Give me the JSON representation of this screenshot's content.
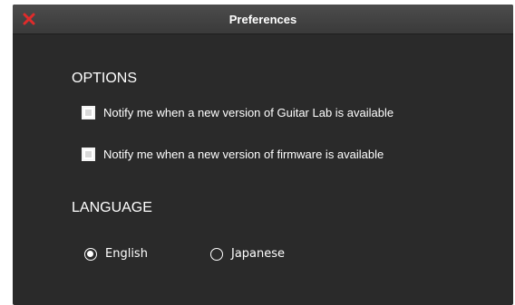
{
  "window": {
    "title": "Preferences"
  },
  "colors": {
    "background": "#2a2a2a",
    "titlebar": "#434343",
    "close_icon": "#e02b2b",
    "text": "#ffffff"
  },
  "options": {
    "heading": "OPTIONS",
    "items": [
      {
        "label": "Notify me when a new version of Guitar Lab is available",
        "checked": true
      },
      {
        "label": "Notify me when a new version of firmware is available",
        "checked": true
      }
    ]
  },
  "language": {
    "heading": "LANGUAGE",
    "selected": "English",
    "choices": [
      {
        "label": "English",
        "selected": true
      },
      {
        "label": "Japanese",
        "selected": false
      }
    ]
  }
}
